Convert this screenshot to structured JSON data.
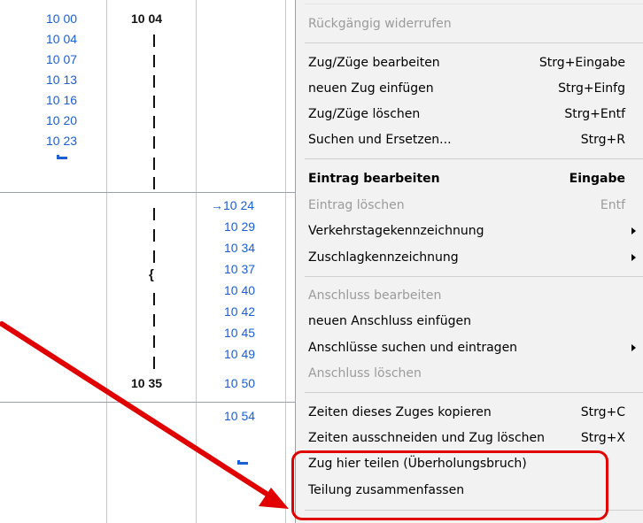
{
  "timetable": {
    "col1_times": [
      "10 00",
      "10 04",
      "10 07",
      "10 13",
      "10 16",
      "10 20",
      "10 23"
    ],
    "col2_arrival": "10 04",
    "col2_departure": "10 35",
    "col3_times": [
      "10 29",
      "10 34",
      "10 37",
      "10 40",
      "10 42",
      "10 45",
      "10 49",
      "10 50",
      "10 54"
    ],
    "col3_first": "→10 24"
  },
  "menu": {
    "undo_label": "Rückgängig widerrufen",
    "items": [
      {
        "label": "Zug/Züge bearbeiten",
        "shortcut": "Strg+Eingabe",
        "enabled": true
      },
      {
        "label": "neuen Zug einfügen",
        "shortcut": "Strg+Einfg",
        "enabled": true
      },
      {
        "label": "Zug/Züge löschen",
        "shortcut": "Strg+Entf",
        "enabled": true
      },
      {
        "label": "Suchen und Ersetzen...",
        "shortcut": "Strg+R",
        "enabled": true
      },
      {
        "label": "Eintrag bearbeiten",
        "shortcut": "Eingabe",
        "enabled": true,
        "bold": true
      },
      {
        "label": "Eintrag löschen",
        "shortcut": "Entf",
        "enabled": false
      },
      {
        "label": "Verkehrstagekennzeichnung",
        "submenu": true,
        "enabled": true
      },
      {
        "label": "Zuschlagkennzeichnung",
        "submenu": true,
        "enabled": true
      },
      {
        "label": "Anschluss bearbeiten",
        "enabled": false
      },
      {
        "label": "neuen Anschluss einfügen",
        "enabled": true
      },
      {
        "label": "Anschlüsse suchen und eintragen",
        "submenu": true,
        "enabled": true
      },
      {
        "label": "Anschluss löschen",
        "enabled": false
      },
      {
        "label": "Zeiten dieses Zuges kopieren",
        "shortcut": "Strg+C",
        "enabled": true
      },
      {
        "label": "Zeiten ausschneiden und Zug löschen",
        "shortcut": "Strg+X",
        "enabled": true
      },
      {
        "label": "Zug hier teilen (Überholungsbruch)",
        "enabled": true
      },
      {
        "label": "Teilung zusammenfassen",
        "enabled": true
      }
    ]
  },
  "annotation": {
    "color": "#e00000"
  }
}
